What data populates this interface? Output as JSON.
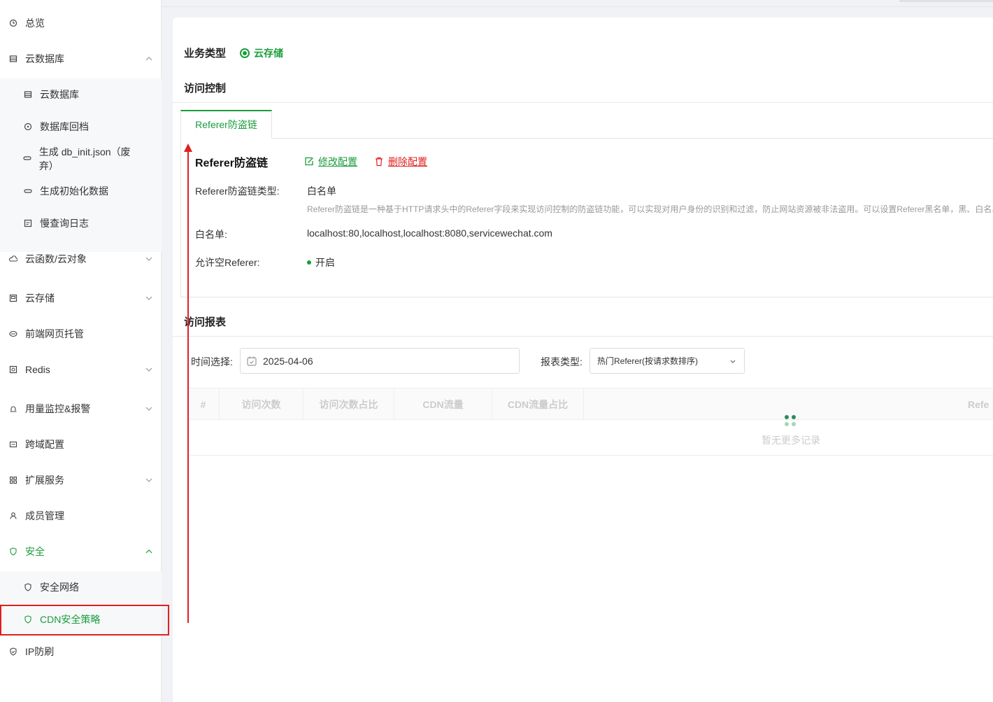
{
  "sidebar": {
    "items": [
      {
        "label": "总览",
        "icon": "clock-icon"
      },
      {
        "label": "云数据库",
        "icon": "database-icon",
        "expanded": true
      },
      {
        "label": "云数据库",
        "icon": "database-icon",
        "sub": true
      },
      {
        "label": "数据库回档",
        "icon": "restore-icon",
        "sub": true
      },
      {
        "label": "生成 db_init.json（废弃）",
        "icon": "link-icon",
        "sub": true
      },
      {
        "label": "生成初始化数据",
        "icon": "link-icon",
        "sub": true
      },
      {
        "label": "慢查询日志",
        "icon": "log-icon",
        "sub": true
      },
      {
        "label": "云函数/云对象",
        "icon": "cloud-icon",
        "expanded": false
      },
      {
        "label": "云存储",
        "icon": "storage-icon",
        "expanded": false
      },
      {
        "label": "前端网页托管",
        "icon": "web-hosting-icon"
      },
      {
        "label": "Redis",
        "icon": "redis-icon",
        "expanded": false
      },
      {
        "label": "用量监控&报警",
        "icon": "alarm-icon",
        "expanded": false
      },
      {
        "label": "跨域配置",
        "icon": "cors-icon"
      },
      {
        "label": "扩展服务",
        "icon": "grid-icon",
        "expanded": false
      },
      {
        "label": "成员管理",
        "icon": "user-icon"
      },
      {
        "label": "安全",
        "icon": "shield-icon",
        "expanded": true,
        "active": true
      },
      {
        "label": "安全网络",
        "icon": "shield-icon",
        "sub": true
      },
      {
        "label": "CDN安全策略",
        "icon": "shield-icon",
        "sub": true,
        "active": true
      },
      {
        "label": "IP防刷",
        "icon": "shield-check-icon"
      }
    ]
  },
  "main": {
    "business_type_label": "业务类型",
    "business_type_value": "云存储",
    "access_control_title": "访问控制",
    "tab_label": "Referer防盗链",
    "referer": {
      "title": "Referer防盗链",
      "edit_label": "修改配置",
      "delete_label": "删除配置",
      "type_key": "Referer防盗链类型:",
      "type_value": "白名单",
      "description": "Referer防盗链是一种基于HTTP请求头中的Referer字段来实现访问控制的防盗链功能，可以实现对用户身份的识别和过滤，防止网站资源被非法盗用。可以设置Referer黑名单，黑、白名单",
      "whitelist_key": "白名单:",
      "whitelist_value": "localhost:80,localhost,localhost:8080,servicewechat.com",
      "allow_empty_key": "允许空Referer:",
      "allow_empty_value": "开启"
    },
    "report": {
      "title": "访问报表",
      "time_label": "时间选择:",
      "date_value": "2025-04-06",
      "type_label": "报表类型:",
      "type_value": "热门Referer(按请求数排序)",
      "columns": [
        "#",
        "访问次数",
        "访问次数占比",
        "CDN流量",
        "CDN流量占比",
        "Refe"
      ],
      "empty_text": "暂无更多记录"
    }
  },
  "colors": {
    "accent": "#1a9c3c",
    "danger": "#e02020"
  }
}
